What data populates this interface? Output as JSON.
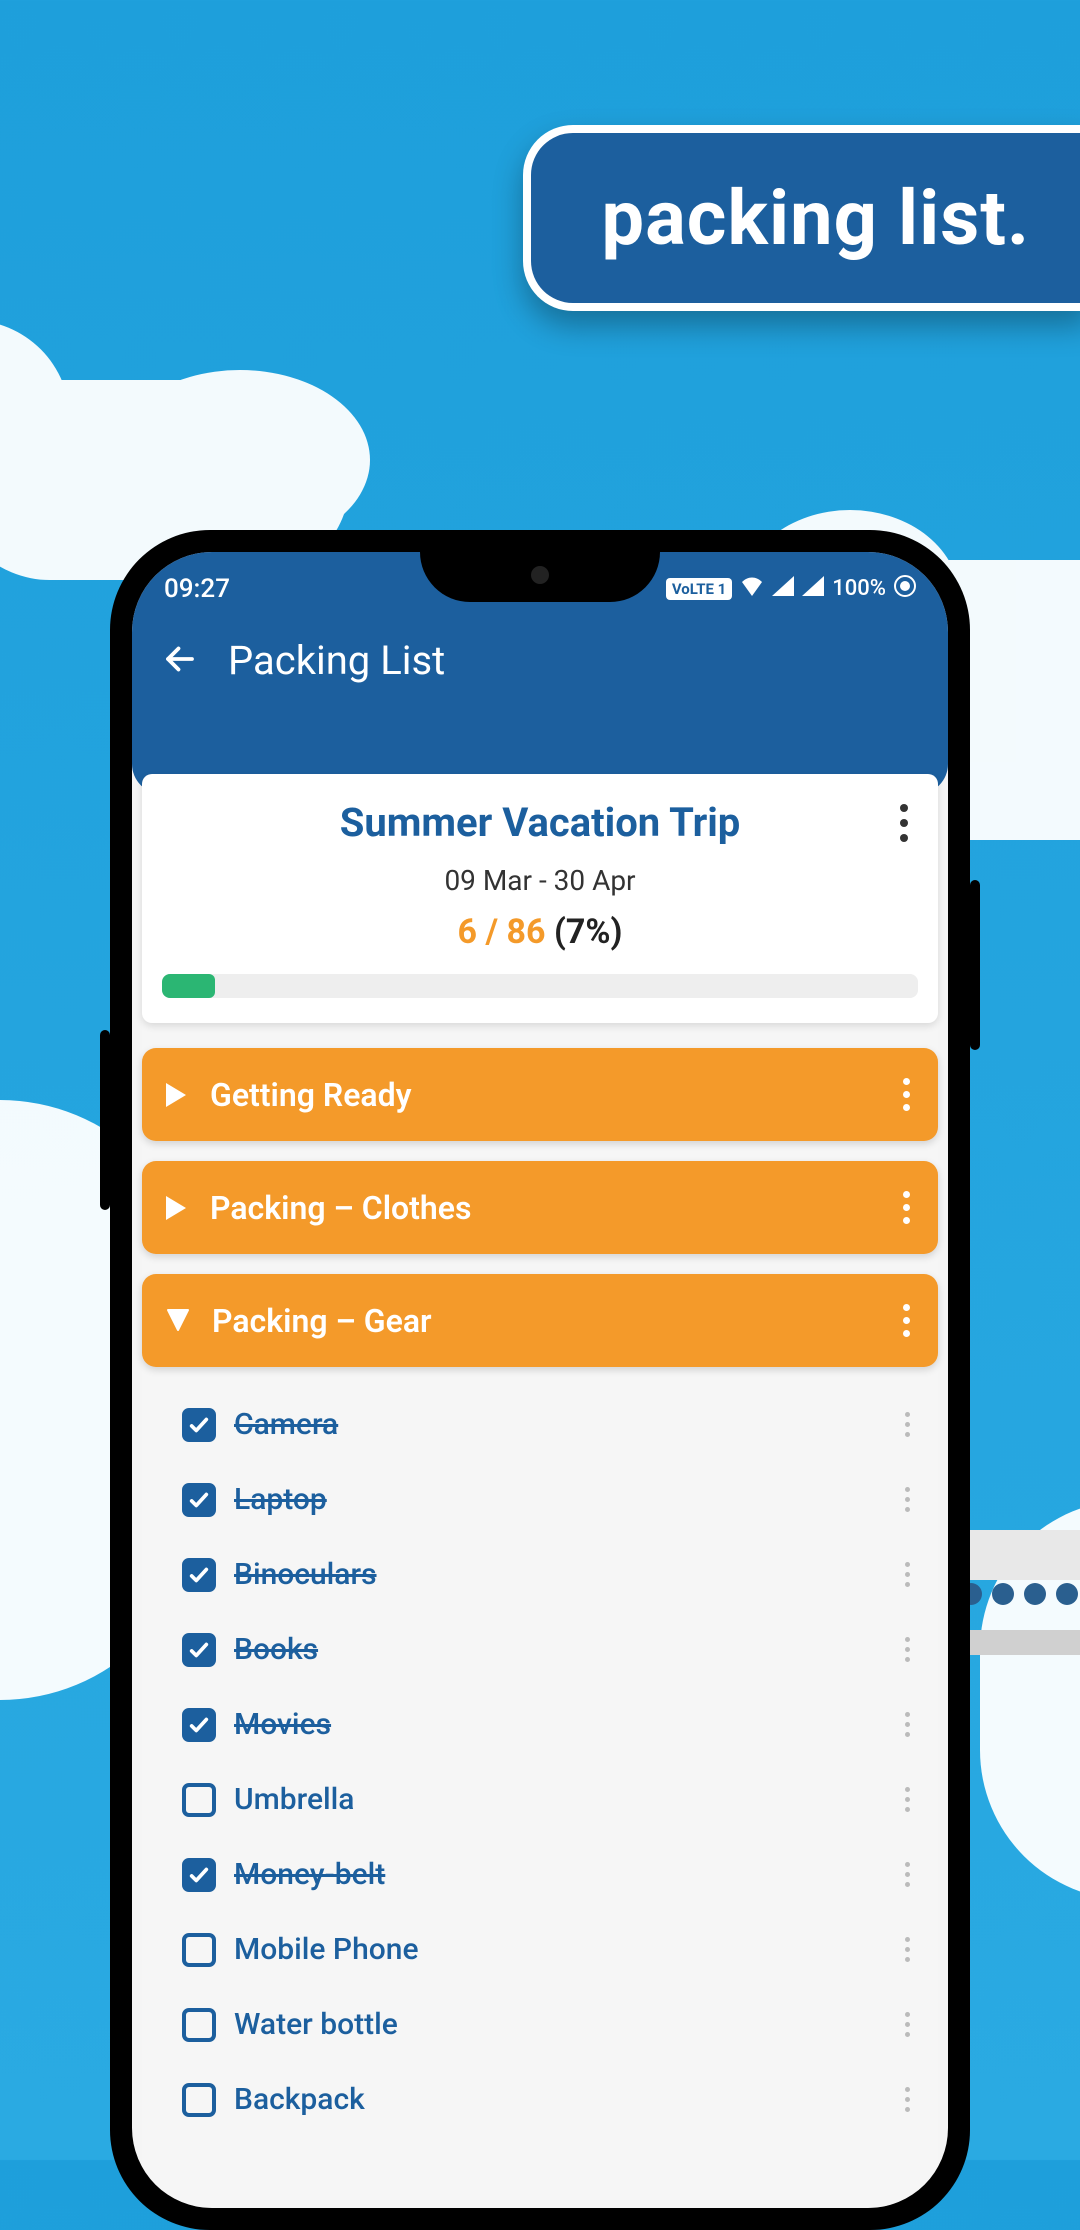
{
  "promo": {
    "label": "packing list."
  },
  "status_bar": {
    "time": "09:27",
    "volte": "VoLTE 1",
    "battery": "100%"
  },
  "app_bar": {
    "title": "Packing List"
  },
  "trip": {
    "title": "Summer Vacation Trip",
    "date_range": "09 Mar - 30 Apr",
    "done": "6",
    "total": "86",
    "percent": "(7%)",
    "progress_pct": 7
  },
  "sections": [
    {
      "label": "Getting Ready",
      "expanded": false
    },
    {
      "label": "Packing – Clothes",
      "expanded": false
    },
    {
      "label": "Packing – Gear",
      "expanded": true
    }
  ],
  "gear_items": [
    {
      "label": "Camera",
      "checked": true
    },
    {
      "label": "Laptop",
      "checked": true
    },
    {
      "label": "Binoculars",
      "checked": true
    },
    {
      "label": "Books",
      "checked": true
    },
    {
      "label": "Movies",
      "checked": true
    },
    {
      "label": "Umbrella",
      "checked": false
    },
    {
      "label": "Money-belt",
      "checked": true
    },
    {
      "label": "Mobile Phone",
      "checked": false
    },
    {
      "label": "Water bottle",
      "checked": false
    },
    {
      "label": "Backpack",
      "checked": false
    }
  ],
  "colors": {
    "brand_blue": "#1C5F9E",
    "accent_orange": "#F49A2A",
    "progress_green": "#2BB673",
    "sky": "#1E9FDB"
  }
}
